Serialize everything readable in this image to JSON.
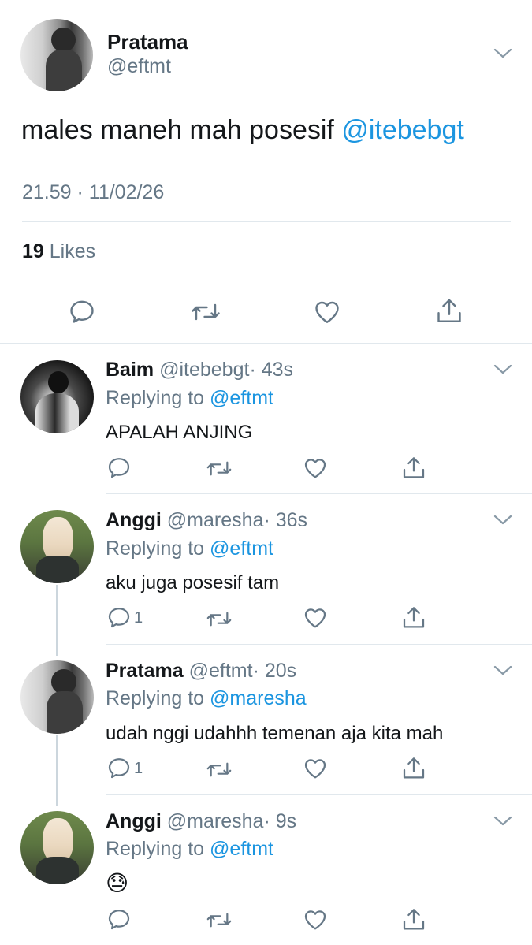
{
  "main_tweet": {
    "name": "Pratama",
    "handle": "@eftmt",
    "text": "males maneh mah posesif ",
    "mention": "@itebebgt",
    "timestamp": "21.59 · 11/02/26",
    "likes_count": "19",
    "likes_label": "Likes"
  },
  "replies": [
    {
      "name": "Baim",
      "handle": "@itebebgt",
      "time": "· 43s",
      "replying_label": "Replying to",
      "replying_to": "@eftmt",
      "text": "APALAH ANJING",
      "reply_count": ""
    },
    {
      "name": "Anggi",
      "handle": "@maresha",
      "time": "· 36s",
      "replying_label": "Replying to",
      "replying_to": "@eftmt",
      "text": "aku juga posesif tam",
      "reply_count": "1"
    },
    {
      "name": "Pratama",
      "handle": "@eftmt",
      "time": "· 20s",
      "replying_label": "Replying to",
      "replying_to": "@maresha",
      "text": "udah nggi udahhh temenan aja kita mah",
      "reply_count": "1"
    },
    {
      "name": "Anggi",
      "handle": "@maresha",
      "time": "· 9s",
      "replying_label": "Replying to",
      "replying_to": "@eftmt",
      "text": "😓",
      "reply_count": ""
    }
  ],
  "icons": {
    "reply": "reply-icon",
    "retweet": "retweet-icon",
    "like": "heart-icon",
    "share": "share-icon",
    "more": "chevron-down-icon"
  },
  "colors": {
    "link_blue": "#1b95e0",
    "muted_gray": "#657786",
    "divider": "#e1e8ed"
  }
}
